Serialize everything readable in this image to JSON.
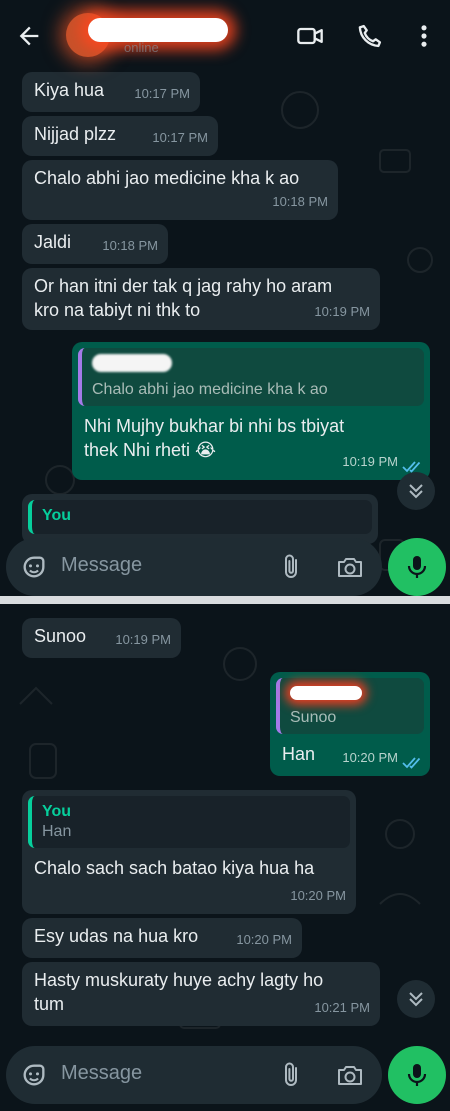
{
  "header": {
    "status": "online"
  },
  "top_panel": {
    "messages": [
      {
        "dir": "in",
        "text": "Kiya hua",
        "time": "10:17 PM"
      },
      {
        "dir": "in",
        "text": "Nijjad plzz",
        "time": "10:17 PM"
      },
      {
        "dir": "in",
        "text": "Chalo abhi jao medicine kha k ao",
        "time": "10:18 PM"
      },
      {
        "dir": "in",
        "text": "Jaldi",
        "time": "10:18 PM"
      },
      {
        "dir": "in",
        "text_line1": "Or han itni der tak q jag rahy ho aram",
        "text_line2": "kro na tabiyt ni thk to",
        "time": "10:19 PM"
      },
      {
        "dir": "out",
        "quote_text": "Chalo abhi jao medicine kha k ao",
        "text_line1": "Nhi Mujhy bukhar bi nhi bs tbiyat",
        "text_line2": "thek Nhi rheti 😭",
        "time": "10:19 PM"
      },
      {
        "dir": "in",
        "quote_author": "You"
      }
    ],
    "input_placeholder": "Message"
  },
  "bottom_panel": {
    "messages": [
      {
        "dir": "in",
        "text": "Sunoo",
        "time": "10:19 PM"
      },
      {
        "dir": "out",
        "quote_text": "Sunoo",
        "text": "Han",
        "time": "10:20 PM"
      },
      {
        "dir": "in",
        "quote_author": "You",
        "quote_text": "Han",
        "text": "Chalo sach sach batao kiya hua ha",
        "time": "10:20 PM"
      },
      {
        "dir": "in",
        "text": "Esy udas na hua kro",
        "time": "10:20 PM"
      },
      {
        "dir": "in",
        "text_line1": "Hasty muskuraty huye achy lagty ho",
        "text_line2": "tum",
        "time": "10:21 PM"
      }
    ],
    "input_placeholder": "Message"
  },
  "colors": {
    "background": "#0b141a",
    "incoming_bubble": "#202c33",
    "outgoing_bubble": "#005c4b",
    "accent_green": "#21c063",
    "read_ticks": "#53bdeb"
  },
  "icons": [
    "back-arrow-icon",
    "video-call-icon",
    "voice-call-icon",
    "more-options-icon",
    "sticker-icon",
    "attach-icon",
    "camera-icon",
    "mic-icon",
    "scroll-down-icon",
    "double-check-icon"
  ]
}
